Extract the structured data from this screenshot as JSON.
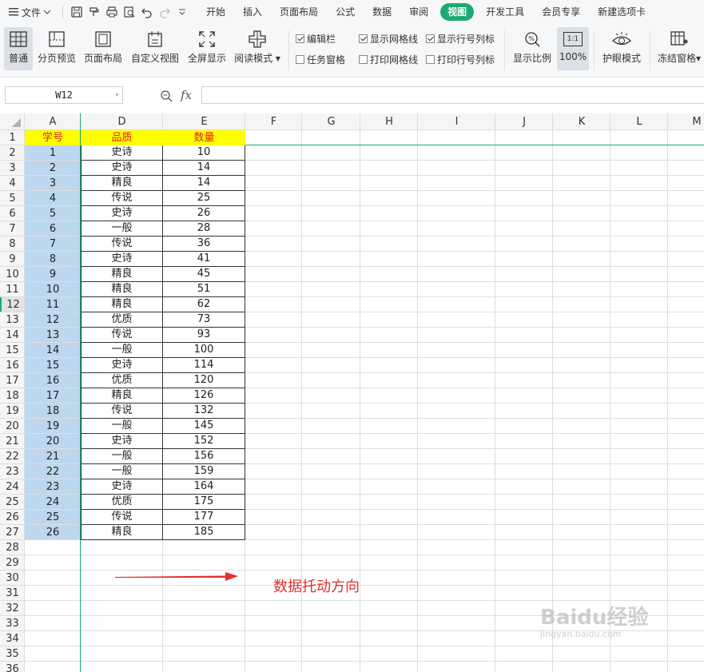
{
  "menubar": {
    "file_label": "文件",
    "tabs": [
      "开始",
      "插入",
      "页面布局",
      "公式",
      "数据",
      "审阅",
      "视图",
      "开发工具",
      "会员专享",
      "新建选项卡"
    ],
    "active_tab": "视图"
  },
  "ribbon": {
    "normal": "普通",
    "page_break_preview": "分页预览",
    "page_layout": "页面布局",
    "custom_view": "自定义视图",
    "full_screen": "全屏显示",
    "reading_mode": "阅读模式",
    "checkboxes": {
      "formula_bar": {
        "label": "编辑栏",
        "checked": true
      },
      "task_pane": {
        "label": "任务窗格",
        "checked": false
      },
      "show_gridlines": {
        "label": "显示网格线",
        "checked": true
      },
      "print_gridlines": {
        "label": "打印网格线",
        "checked": false
      },
      "show_headings": {
        "label": "显示行号列标",
        "checked": true
      },
      "print_headings": {
        "label": "打印行号列标",
        "checked": false
      }
    },
    "zoom": "显示比例",
    "zoom_100": "100%",
    "zoom_100_icon": "1:1",
    "eye_protection": "护眼模式",
    "freeze_panes": "冻结窗格"
  },
  "formula_bar": {
    "name_box": "W12",
    "fx": "fx",
    "value": ""
  },
  "sheet": {
    "columns": [
      "A",
      "D",
      "E",
      "F",
      "G",
      "H",
      "I",
      "J",
      "K",
      "L",
      "M"
    ],
    "row_numbers": [
      "1",
      "2",
      "3",
      "4",
      "5",
      "6",
      "7",
      "8",
      "9",
      "10",
      "11",
      "12",
      "13",
      "14",
      "15",
      "16",
      "17",
      "18",
      "19",
      "20",
      "21",
      "22",
      "23",
      "24",
      "25",
      "26",
      "27",
      "28",
      "29",
      "30",
      "31",
      "32",
      "33",
      "34",
      "35",
      "36"
    ],
    "headers": [
      "学号",
      "品质",
      "数量"
    ],
    "rows": [
      [
        "1",
        "史诗",
        "10"
      ],
      [
        "2",
        "史诗",
        "14"
      ],
      [
        "3",
        "精良",
        "14"
      ],
      [
        "4",
        "传说",
        "25"
      ],
      [
        "5",
        "史诗",
        "26"
      ],
      [
        "6",
        "一般",
        "28"
      ],
      [
        "7",
        "传说",
        "36"
      ],
      [
        "8",
        "史诗",
        "41"
      ],
      [
        "9",
        "精良",
        "45"
      ],
      [
        "10",
        "精良",
        "51"
      ],
      [
        "11",
        "精良",
        "62"
      ],
      [
        "12",
        "优质",
        "73"
      ],
      [
        "13",
        "传说",
        "93"
      ],
      [
        "14",
        "一般",
        "100"
      ],
      [
        "15",
        "史诗",
        "114"
      ],
      [
        "16",
        "优质",
        "120"
      ],
      [
        "17",
        "精良",
        "126"
      ],
      [
        "18",
        "传说",
        "132"
      ],
      [
        "19",
        "一般",
        "145"
      ],
      [
        "20",
        "史诗",
        "152"
      ],
      [
        "21",
        "一般",
        "156"
      ],
      [
        "22",
        "一般",
        "159"
      ],
      [
        "23",
        "史诗",
        "164"
      ],
      [
        "24",
        "优质",
        "175"
      ],
      [
        "25",
        "传说",
        "177"
      ],
      [
        "26",
        "精良",
        "185"
      ]
    ]
  },
  "annotation": "数据托动方向",
  "watermark": {
    "brand": "Baidu经验",
    "url": "jingyan.baidu.com"
  },
  "colors": {
    "accent": "#1aaa72",
    "header_fill": "#ffff00",
    "header_text": "#e02020",
    "selection_fill": "#bdd7ee",
    "annotation": "#e03030"
  }
}
